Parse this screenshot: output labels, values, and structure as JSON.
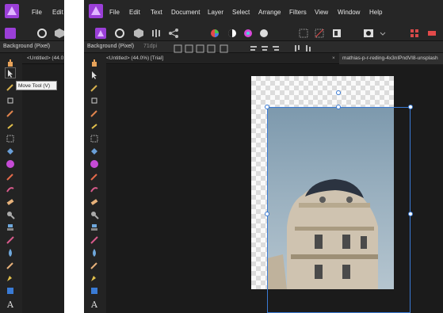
{
  "left_window": {
    "menu": [
      "File",
      "Edit"
    ],
    "context_label": "Background (Pixel)",
    "tab_label": "<Untitled> (44.0",
    "tooltip": "Move Tool (V)"
  },
  "right_window": {
    "menu": [
      "File",
      "Edit",
      "Text",
      "Document",
      "Layer",
      "Select",
      "Arrange",
      "Filters",
      "View",
      "Window",
      "Help"
    ],
    "context_label": "Background (Pixel)",
    "dpi": "71dpi",
    "tabs": [
      {
        "label": "<Untitled> (44.0%) [Trial]"
      },
      {
        "label": "mathias-p-r-reding-4x3nIPndVI8-unsplash"
      }
    ],
    "tab_close": "×"
  },
  "colors": {
    "ui_bg": "#1e1e1e",
    "menubar": "#262626",
    "selection": "#3a7bd5",
    "app_logo": "#9b3fd8",
    "sky": "#8ea8ba"
  },
  "icons": [
    "app-logo-icon",
    "move-tool-icon",
    "hand-tool-icon",
    "crop-tool-icon",
    "brush-tool-icon",
    "fill-tool-icon",
    "text-tool-icon"
  ]
}
